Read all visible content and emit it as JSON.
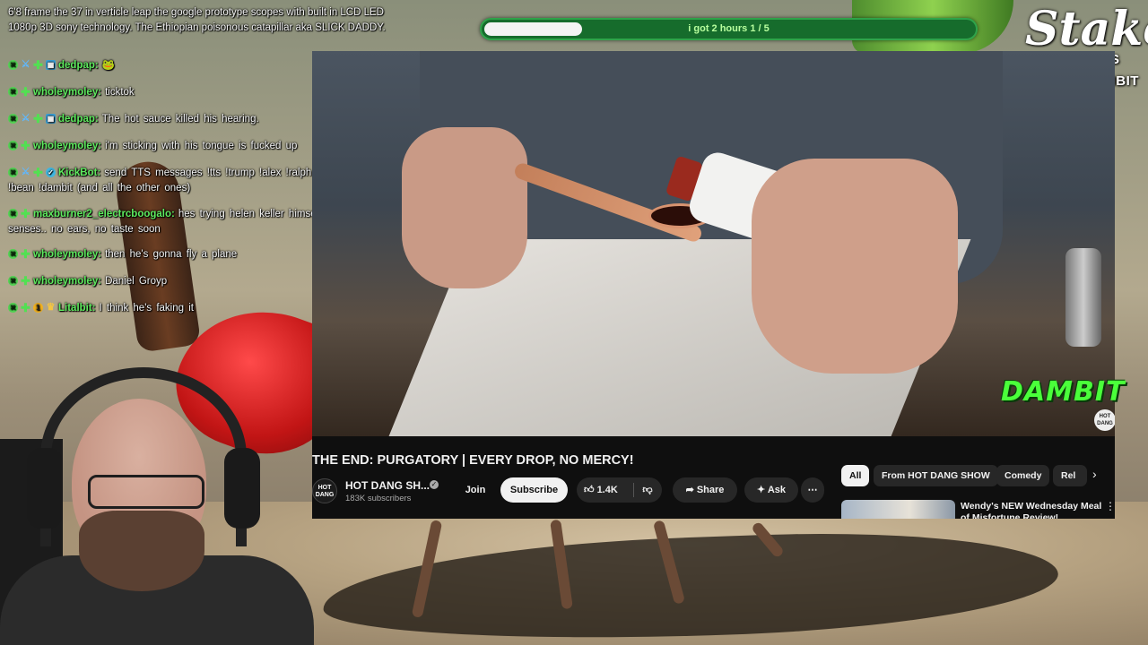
{
  "chat": {
    "top_partial": "6'8 frame the 37 in verticle leap the google prototype scopes with built in LCD LED 1080p 3D sony technology. The Ethiopian poisonous catapillar aka SLICK DADDY.",
    "messages": [
      {
        "user": "dedpap:",
        "text": "",
        "badges": [
          "x-badge",
          "sword-badge",
          "plus-badge",
          "grid-badge"
        ]
      },
      {
        "user": "wholeymoley:",
        "text": "ticktok",
        "badges": [
          "x-badge",
          "plus-badge"
        ]
      },
      {
        "user": "dedpap:",
        "text": "The hot sauce killed his hearing.",
        "badges": [
          "x-badge",
          "sword-badge",
          "plus-badge",
          "grid-badge"
        ]
      },
      {
        "user": "wholeymoley:",
        "text": "i'm sticking with his tongue is fucked up",
        "badges": [
          "x-badge",
          "plus-badge"
        ]
      },
      {
        "user": "KickBot:",
        "text": "send TTS messages !tts !trump !alex !ralph !njf !tucker !teddy !bean !dambit (and all the other ones)",
        "badges": [
          "x-badge",
          "sword-badge",
          "plus-badge",
          "check-badge"
        ]
      },
      {
        "user": "maxburner2_electrcboogalo:",
        "text": "hes trying helen keller himself and lose all his senses.. no ears, no taste soon",
        "badges": [
          "x-badge",
          "plus-badge"
        ]
      },
      {
        "user": "wholeymoley:",
        "text": "then he's gonna fly a plane",
        "badges": [
          "x-badge",
          "plus-badge"
        ]
      },
      {
        "user": "wholeymoley:",
        "text": "Daniel Groyp",
        "badges": [
          "x-badge",
          "plus-badge"
        ]
      },
      {
        "user": "Litalbit:",
        "text": "I think he's faking it",
        "badges": [
          "x-badge",
          "plus-badge",
          "number-badge",
          "crown-badge"
        ]
      }
    ],
    "number_badge": "1",
    "username_color": "#5eea5e"
  },
  "progress": {
    "label": "i got 2 hours 1 / 5",
    "fraction": 0.2,
    "fill_color": "#f3f3f3",
    "track_color": "#166c2c"
  },
  "stake": {
    "logo": "Stake",
    "suffix": ".US",
    "code": "CODE: DAMBIT"
  },
  "youtube": {
    "video_title": "THE END: PURGATORY | EVERY DROP, NO MERCY!",
    "watermark": "HOT DANG",
    "channel": {
      "avatar_text": "HOT DANG",
      "name": "HOT DANG SH...",
      "subscribers": "183K subscribers"
    },
    "actions": {
      "join": "Join",
      "subscribe": "Subscribe",
      "likes": "1.4K",
      "share": "Share",
      "ask": "Ask",
      "more": "⋯"
    },
    "chips": [
      "All",
      "From HOT DANG SHOW",
      "Comedy",
      "Rel"
    ],
    "recommendation": {
      "title": "Wendy's NEW Wednesday Meal of Misfortune Review!"
    }
  },
  "overlay": {
    "dambit": "DAMBIT"
  },
  "icons": {
    "like": "thumb-up-icon",
    "dislike": "thumb-down-icon",
    "share": "share-icon",
    "ask": "sparkle-icon",
    "verified": "check-icon",
    "chip_next": "chevron-right-icon"
  }
}
